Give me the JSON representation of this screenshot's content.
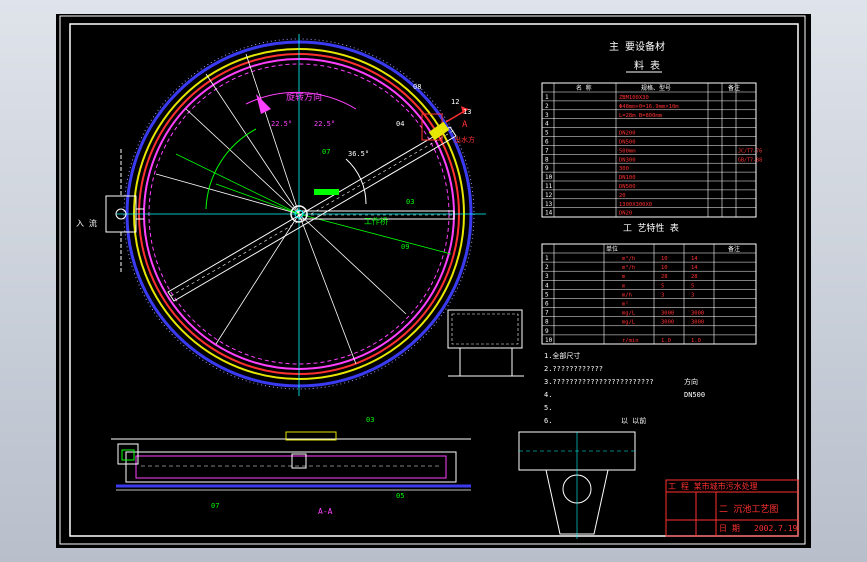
{
  "equipment": {
    "title": "主 要设备材",
    "subtitle": "料 表",
    "col_name": "名 称",
    "col_spec": "规格、型号",
    "col_remark": "备注",
    "rows": [
      {
        "no": "1",
        "spec": "ZBM100X30"
      },
      {
        "no": "2",
        "spec": "Φ48mm×0=16.9mm×10m"
      },
      {
        "no": "3",
        "spec": "L=28m  B=800mm"
      },
      {
        "no": "4",
        "spec": ""
      },
      {
        "no": "5",
        "spec": "DN200"
      },
      {
        "no": "6",
        "spec": "DN500"
      },
      {
        "no": "7",
        "spec": "500mm",
        "remark": "JC/T7-76"
      },
      {
        "no": "8",
        "spec": "DN300",
        "remark": "GB/T7-88"
      },
      {
        "no": "9",
        "spec": "300"
      },
      {
        "no": "10",
        "spec": "DN100"
      },
      {
        "no": "11",
        "spec": "DN500"
      },
      {
        "no": "12",
        "spec": "20"
      },
      {
        "no": "13",
        "spec": "1300X300X0"
      },
      {
        "no": "14",
        "spec": "DN20"
      }
    ]
  },
  "process": {
    "title": "工 艺特性 表",
    "col_unit": "单位",
    "col_remark": "备注",
    "rows": [
      {
        "no": "1",
        "unit": "m³/h",
        "v1": "10",
        "v2": "14"
      },
      {
        "no": "2",
        "unit": "m³/h",
        "v1": "10",
        "v2": "14"
      },
      {
        "no": "3",
        "unit": "m",
        "v1": "28",
        "v2": "28"
      },
      {
        "no": "4",
        "unit": "m",
        "v1": "5",
        "v2": "5"
      },
      {
        "no": "5",
        "unit": "m/h",
        "v1": "3",
        "v2": "3"
      },
      {
        "no": "6",
        "unit": "m²",
        "v1": "",
        "v2": ""
      },
      {
        "no": "7",
        "unit": "mg/L",
        "v1": "3000",
        "v2": "3000"
      },
      {
        "no": "8",
        "unit": "mg/L",
        "v1": "3000",
        "v2": "3000"
      },
      {
        "no": "9",
        "unit": "",
        "v1": "",
        "v2": ""
      },
      {
        "no": "10",
        "unit": "r/min",
        "v1": "1.0",
        "v2": "1.0"
      }
    ]
  },
  "notes": {
    "n1": "1.全部尺寸",
    "n2": "2.????????????",
    "n3": "3.????????????????????????",
    "n3b": "方向",
    "n4": "4.",
    "n4b": "DN500",
    "n5": "5.",
    "n6": "6.",
    "n6b": "以 以前"
  },
  "title_block": {
    "project": "工 程 某市城市污水处理",
    "drawing": "二 沉池工艺图",
    "date_label": "日 期",
    "date": "2002.7.19"
  },
  "plan": {
    "rotation_label": "旋转方向",
    "angle1": "22.5°",
    "angle2": "22.5°",
    "angle3": "36.5°",
    "label_07": "07",
    "label_03": "03",
    "label_08": "08",
    "label_04": "04",
    "label_12": "12",
    "label_13": "13",
    "label_09": "09",
    "working_bridge": "工作桥",
    "inlet": "入 流",
    "outlet_label": "出水方",
    "cut_mark": "A"
  },
  "section": {
    "label_03": "03",
    "label_07": "07",
    "label_05": "05",
    "caption": "A-A"
  }
}
